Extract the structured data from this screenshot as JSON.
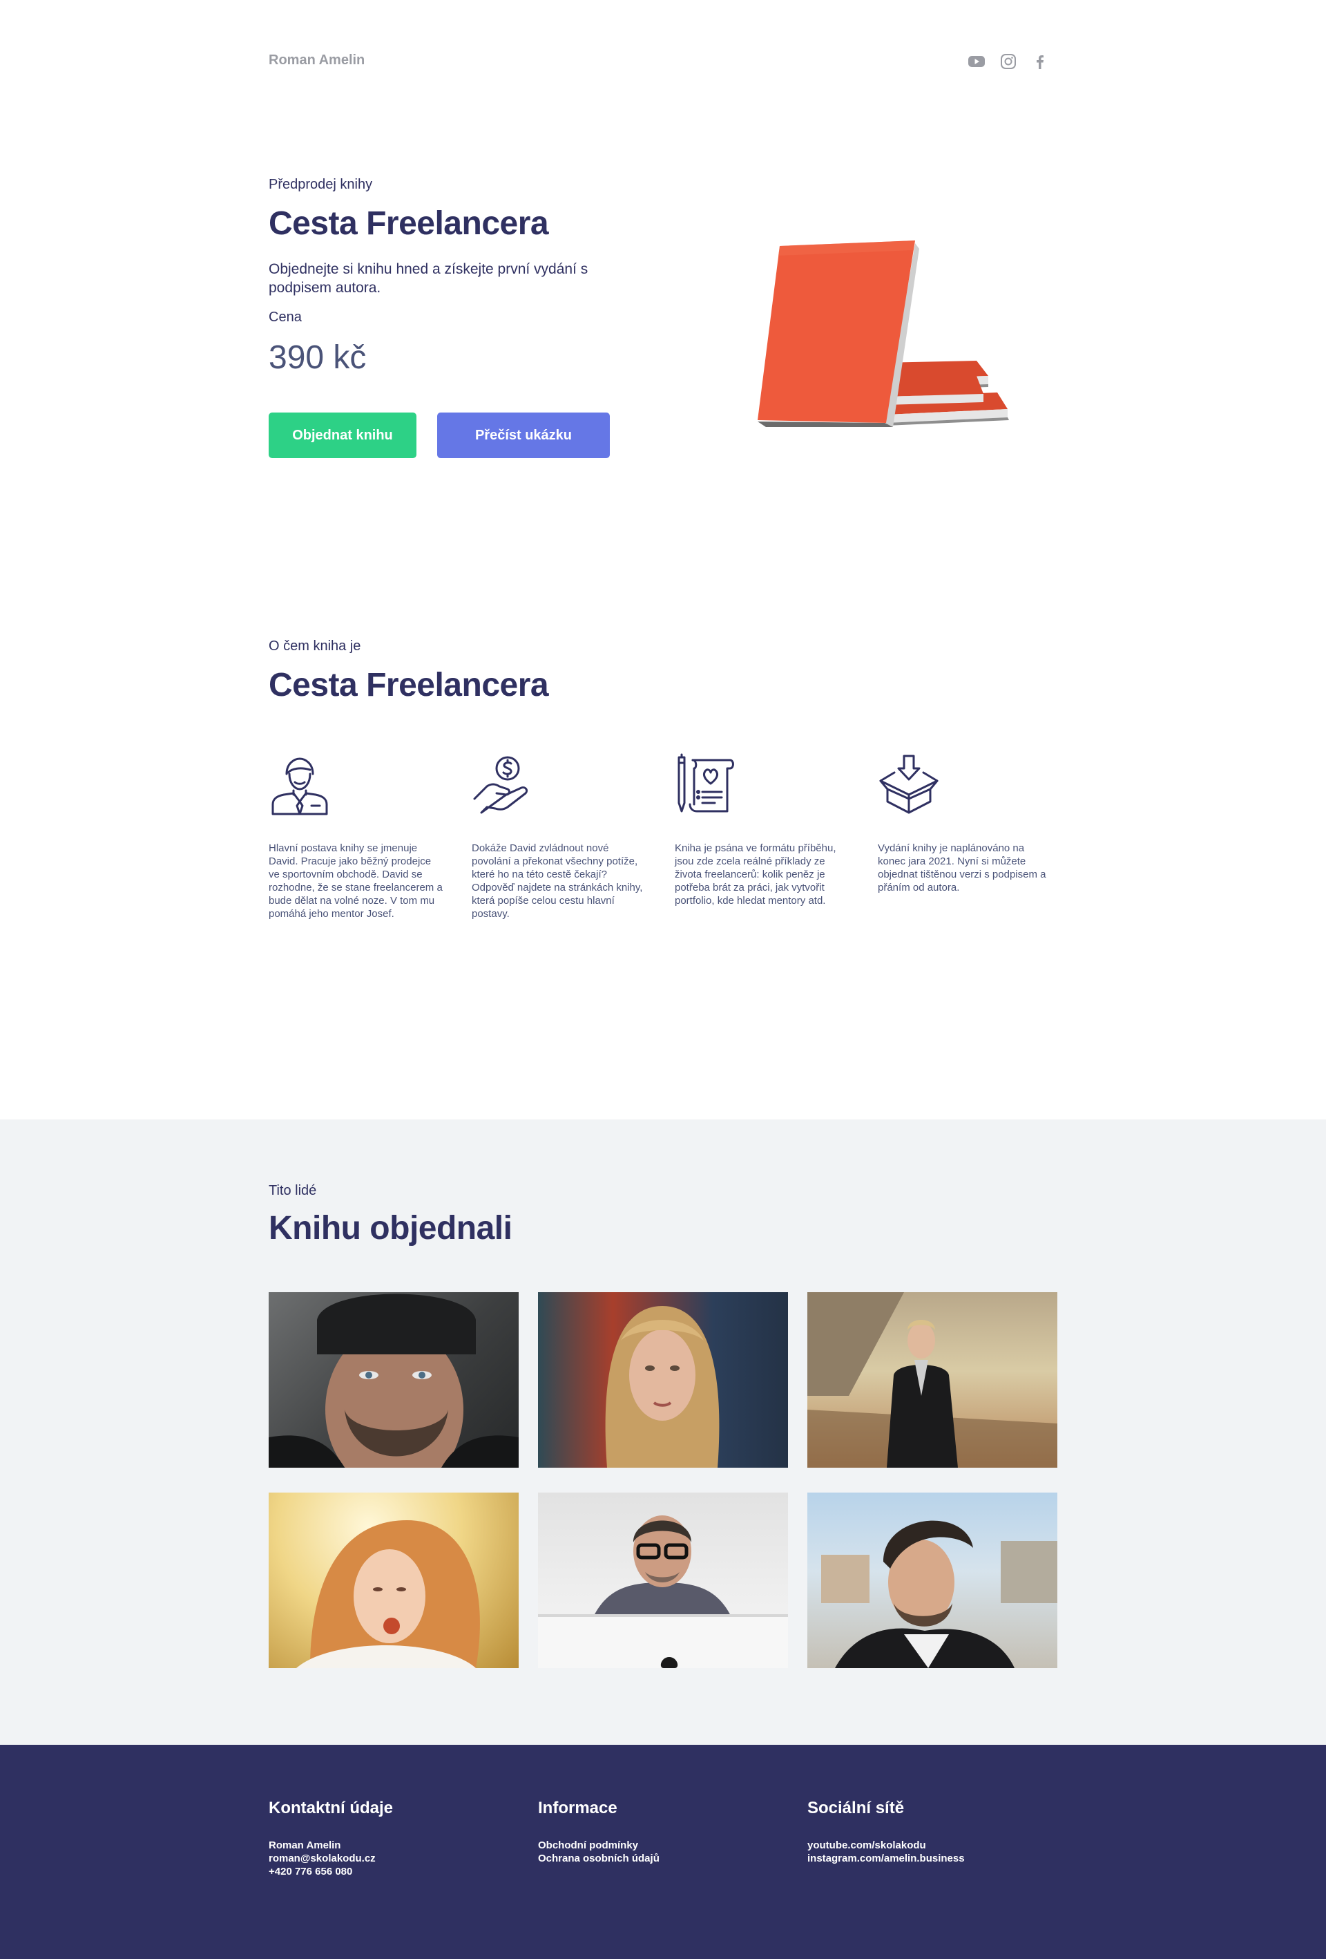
{
  "header": {
    "brand": "Roman Amelin",
    "social": [
      "youtube-icon",
      "instagram-icon",
      "facebook-icon"
    ]
  },
  "hero": {
    "eyebrow": "Předprodej knihy",
    "title": "Cesta Freelancera",
    "lead": "Objednejte si knihu hned a získejte první vydání s podpisem autora.",
    "price_label": "Cena",
    "price": "390 kč",
    "buttons": {
      "order": "Objednat knihu",
      "read": "Přečíst ukázku"
    }
  },
  "about": {
    "eyebrow": "O čem kniha je",
    "title": "Cesta Freelancera",
    "features": [
      {
        "icon": "businessman-icon",
        "text": "Hlavní postava knihy se jmenuje David. Pracuje jako běžný prodejce ve sportovním obchodě. David se rozhodne, že se stane freelancerem a bude dělat na volné noze. V tom mu pomáhá jeho mentor Josef."
      },
      {
        "icon": "money-hand-icon",
        "text": "Dokáže David zvládnout nové povolání a překonat všechny potíže, které ho na této cestě čekají? Odpověď najdete na stránkách knihy, která popíše celou cestu hlavní postavy."
      },
      {
        "icon": "document-pen-icon",
        "text": "Kniha je psána ve formátu příběhu, jsou zde zcela reálné příklady ze života freelancerů: kolik peněz je potřeba brát za práci, jak vytvořit portfolio, kde hledat mentory atd."
      },
      {
        "icon": "package-icon",
        "text": "Vydání knihy je naplánováno na konec jara 2021. Nyní si můžete objednat tištěnou verzi s podpisem a přáním od autora."
      }
    ]
  },
  "people": {
    "eyebrow": "Tito lidé",
    "title": "Knihu objednali"
  },
  "footer": {
    "contact": {
      "title": "Kontaktní údaje",
      "lines": [
        "Roman Amelin",
        "roman@skolakodu.cz",
        "+420 776 656 080"
      ]
    },
    "info": {
      "title": "Informace",
      "lines": [
        "Obchodní podmínky",
        "Ochrana osobních údajů"
      ]
    },
    "social": {
      "title": "Sociální sítě",
      "lines": [
        "youtube.com/skolakodu",
        "instagram.com/amelin.business"
      ]
    }
  },
  "colors": {
    "navy": "#2f3061",
    "green": "#2dd186",
    "blue": "#6577e6",
    "book": "#ee5a3c",
    "gray_bg": "#f1f3f5"
  }
}
